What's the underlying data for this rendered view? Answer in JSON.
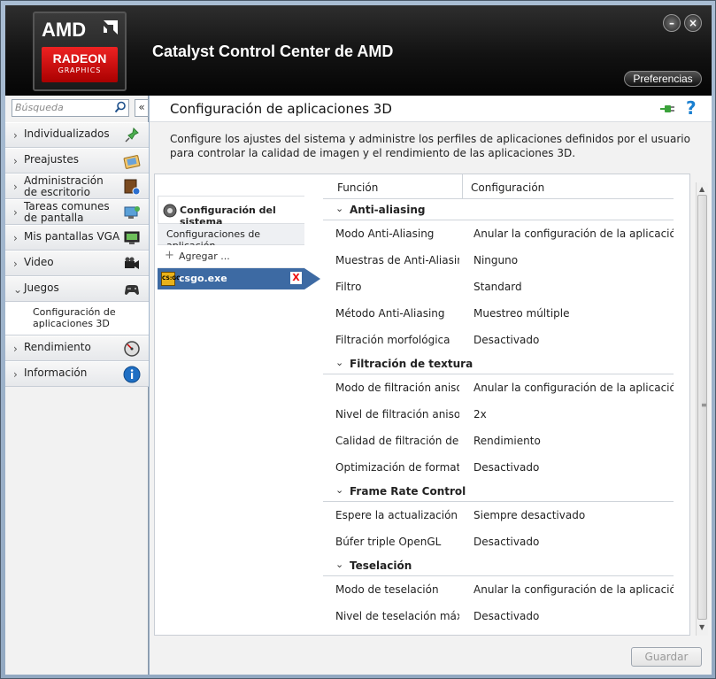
{
  "header": {
    "logo_brand": "AMD",
    "logo_line1": "RADEON",
    "logo_line2": "GRAPHICS",
    "app_title": "Catalyst Control Center de AMD",
    "minimize_symbol": "–",
    "close_symbol": "×",
    "preferences_label": "Preferencias"
  },
  "sidebar": {
    "search_placeholder": "Búsqueda",
    "collapse_symbol": "«",
    "items": [
      {
        "label": "Individualizados",
        "icon": "pin-icon"
      },
      {
        "label": "Preajustes",
        "icon": "preset-icon"
      },
      {
        "label": "Administración de escritorio",
        "icon": "desktop-admin-icon"
      },
      {
        "label": "Tareas comunes de pantalla",
        "icon": "display-tasks-icon"
      },
      {
        "label": "Mis pantallas VGA",
        "icon": "vga-monitor-icon"
      },
      {
        "label": "Video",
        "icon": "video-camera-icon"
      },
      {
        "label": "Juegos",
        "icon": "gamepad-icon",
        "expanded": true
      },
      {
        "label": "Rendimiento",
        "icon": "gauge-icon"
      },
      {
        "label": "Información",
        "icon": "info-icon"
      }
    ],
    "subitem": "Configuración de aplicaciones 3D"
  },
  "main": {
    "title": "Configuración de aplicaciones 3D",
    "help_symbol": "?",
    "description": "Configure los ajustes del sistema y administre los perfiles de aplicaciones definidos por el usuario para controlar la calidad de imagen y el rendimiento de las aplicaciones 3D.",
    "left_nav": {
      "system_settings": "Configuración del sistema",
      "app_settings": "Configuraciones de aplicación",
      "add_label": "Agregar ...",
      "selected_app": "csgo.exe",
      "app_icon_text": "CS:GO",
      "delete_symbol": "X"
    },
    "grid": {
      "col_function": "Función",
      "col_setting": "Configuración",
      "sections": [
        {
          "title": "Anti-aliasing",
          "rows": [
            {
              "k": "Modo Anti-Aliasing",
              "v": "Anular la configuración de la aplicación"
            },
            {
              "k": "Muestras de Anti-Aliasing",
              "v": "Ninguno"
            },
            {
              "k": "Filtro",
              "v": "Standard"
            },
            {
              "k": "Método Anti-Aliasing",
              "v": "Muestreo múltiple"
            },
            {
              "k": "Filtración morfológica",
              "v": "Desactivado"
            }
          ]
        },
        {
          "title": "Filtración de textura",
          "rows": [
            {
              "k": "Modo de filtración aniso...",
              "v": "Anular la configuración de la aplicación"
            },
            {
              "k": "Nivel de filtración anisot...",
              "v": "2x"
            },
            {
              "k": "Calidad de filtración de t...",
              "v": "Rendimiento"
            },
            {
              "k": "Optimización de format...",
              "v": "Desactivado"
            }
          ]
        },
        {
          "title": "Frame Rate Control",
          "rows": [
            {
              "k": "Espere la actualización v...",
              "v": "Siempre desactivado"
            },
            {
              "k": "Búfer triple OpenGL",
              "v": "Desactivado"
            }
          ]
        },
        {
          "title": "Teselación",
          "rows": [
            {
              "k": "Modo de teselación",
              "v": "Anular la configuración de la aplicación"
            },
            {
              "k": "Nivel de teselación máxi...",
              "v": "Desactivado"
            }
          ]
        }
      ]
    },
    "save_label": "Guardar"
  }
}
